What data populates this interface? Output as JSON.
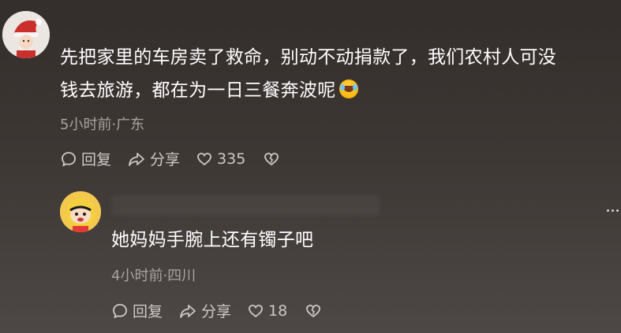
{
  "comments": [
    {
      "text_line1": "先把家里的车房卖了救命，别动不动捐款了，我们农村人可没",
      "text_line2": "钱去旅游，都在为一日三餐奔波呢",
      "emoji_icon": "crying-laughing-emoji",
      "meta": "5小时前·广东",
      "reply_label": "回复",
      "share_label": "分享",
      "like_count": "335"
    },
    {
      "text_line1": "她妈妈手腕上还有镯子吧",
      "meta": "4小时前·四川",
      "reply_label": "回复",
      "share_label": "分享",
      "like_count": "18"
    }
  ],
  "colors": {
    "background_top": "#332d2b",
    "background_bottom": "#4d4745",
    "text_primary": "#ffffff",
    "text_secondary": "#a9a3a0"
  }
}
